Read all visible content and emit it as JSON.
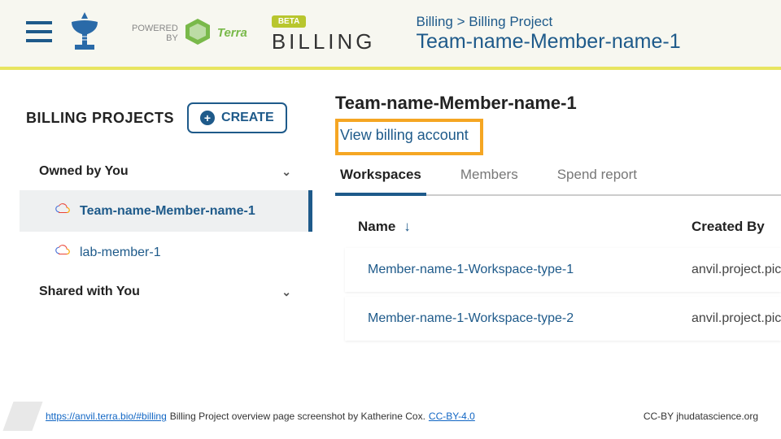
{
  "header": {
    "powered_line1": "POWERED",
    "powered_line2": "BY",
    "terra": "Terra",
    "beta": "BETA",
    "title": "BILLING",
    "crumb_path": "Billing > Billing Project",
    "crumb_name": "Team-name-Member-name-1"
  },
  "sidebar": {
    "title": "BILLING PROJECTS",
    "create_label": "CREATE",
    "sections": [
      {
        "label": "Owned by You"
      },
      {
        "label": "Shared with You"
      }
    ],
    "projects": [
      {
        "label": "Team-name-Member-name-1"
      },
      {
        "label": "lab-member-1"
      }
    ]
  },
  "main": {
    "title": "Team-name-Member-name-1",
    "view_link": "View billing account",
    "tabs": [
      {
        "label": "Workspaces"
      },
      {
        "label": "Members"
      },
      {
        "label": "Spend report"
      }
    ],
    "columns": {
      "name": "Name",
      "created_by": "Created By"
    },
    "rows": [
      {
        "name": "Member-name-1-Workspace-type-1",
        "by": "anvil.project.pic"
      },
      {
        "name": "Member-name-1-Workspace-type-2",
        "by": "anvil.project.pic"
      }
    ]
  },
  "footer": {
    "url_text": "https://anvil.terra.bio/#billing",
    "caption": " Billing Project overview  page screenshot by Katherine Cox. ",
    "license": "CC-BY-4.0",
    "right": "CC-BY  jhudatascience.org"
  }
}
